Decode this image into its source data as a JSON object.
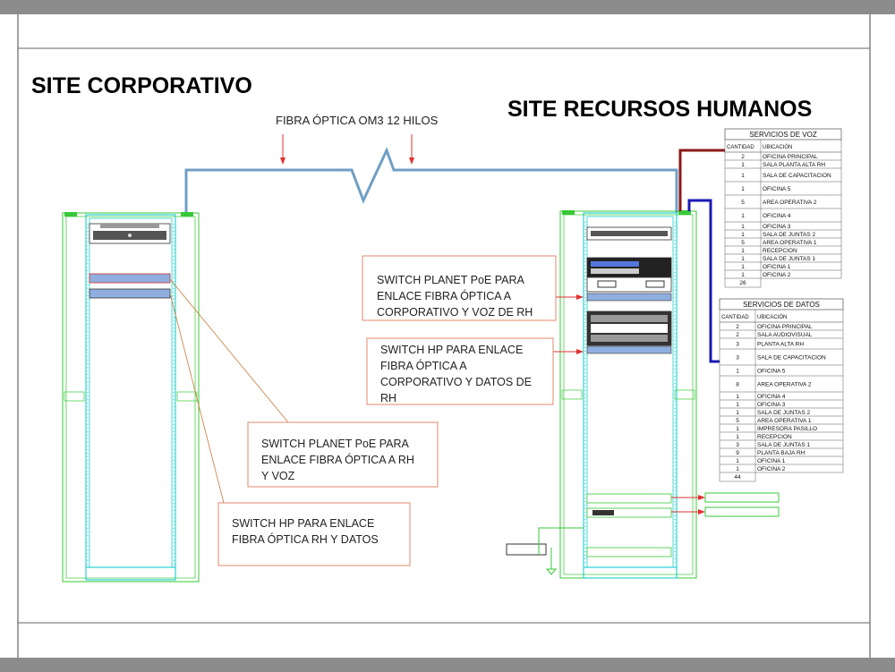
{
  "titles": {
    "left": "SITE CORPORATIVO",
    "right": "SITE RECURSOS HUMANOS",
    "fiber": "FIBRA ÓPTICA OM3  12 HILOS"
  },
  "callouts": {
    "planet_rh": [
      "SWITCH  PLANET  PoE PARA",
      "ENLACE FIBRA ÓPTICA A",
      "CORPORATIVO Y VOZ DE RH"
    ],
    "hp_rh": [
      "SWITCH  HP PARA ENLACE",
      "FIBRA ÓPTICA A",
      "CORPORATIVO Y DATOS DE",
      "RH"
    ],
    "planet_corp": [
      "SWITCH  PLANET  PoE PARA",
      "ENLACE FIBRA ÓPTICA A RH",
      "Y VOZ"
    ],
    "hp_corp": [
      "SWITCH  HP PARA ENLACE",
      "FIBRA ÓPTICA RH Y DATOS"
    ]
  },
  "voz": {
    "title": "SERVICIOS DE VOZ",
    "headers": [
      "CANTIDAD",
      "UBICACIÓN"
    ],
    "rows": [
      [
        "2",
        "OFICINA PRINCIPAL"
      ],
      [
        "1",
        "SALA PLANTA ALTA RH"
      ],
      [
        "1",
        "SALA DE CAPACITACION"
      ],
      [
        "1",
        "OFICINA 5"
      ],
      [
        "5",
        "AREA OPERATIVA 2"
      ],
      [
        "1",
        "OFICINA 4"
      ],
      [
        "1",
        "OFICINA 3"
      ],
      [
        "1",
        "SALA DE JUNTAS 2"
      ],
      [
        "5",
        "AREA OPERATIVA 1"
      ],
      [
        "1",
        "RECEPCION"
      ],
      [
        "1",
        "SALA DE JUNTAS 1"
      ],
      [
        "1",
        "OFICINA 1"
      ],
      [
        "1",
        "OFICINA 2"
      ]
    ],
    "total": "26"
  },
  "datos": {
    "title": "SERVICIOS DE DATOS",
    "headers": [
      "CANTIDAD",
      "UBICACIÓN"
    ],
    "rows": [
      [
        "2",
        "OFICINA PRINCIPAL"
      ],
      [
        "2",
        "SALA AUDIOVISUAL"
      ],
      [
        "3",
        "PLANTA ALTA RH"
      ],
      [
        "3",
        "SALA DE CAPACITACION"
      ],
      [
        "1",
        "OFICINA 5"
      ],
      [
        "8",
        "AREA OPERATIVA 2"
      ],
      [
        "1",
        "OFICINA 4"
      ],
      [
        "1",
        "OFICINA 3"
      ],
      [
        "1",
        "SALA DE JUNTAS 2"
      ],
      [
        "5",
        "AREA OPERATIVA 1"
      ],
      [
        "1",
        "IMPRESORA PASILLO"
      ],
      [
        "1",
        "RECEPCION"
      ],
      [
        "3",
        "SALA DE JUNTAS 1"
      ],
      [
        "9",
        "PLANTA BAJA RH"
      ],
      [
        "1",
        "OFICINA 1"
      ],
      [
        "1",
        "OFICINA 2"
      ]
    ],
    "total": "44"
  },
  "colors": {
    "fiber": "#6f9fc4",
    "rack": "#00c8c8",
    "rack_outer": "#37c837",
    "voz_link": "#8b1a1a",
    "datos_link": "#1a1ab4",
    "arrow": "#e03030",
    "callout_border": "#e28a6e"
  }
}
